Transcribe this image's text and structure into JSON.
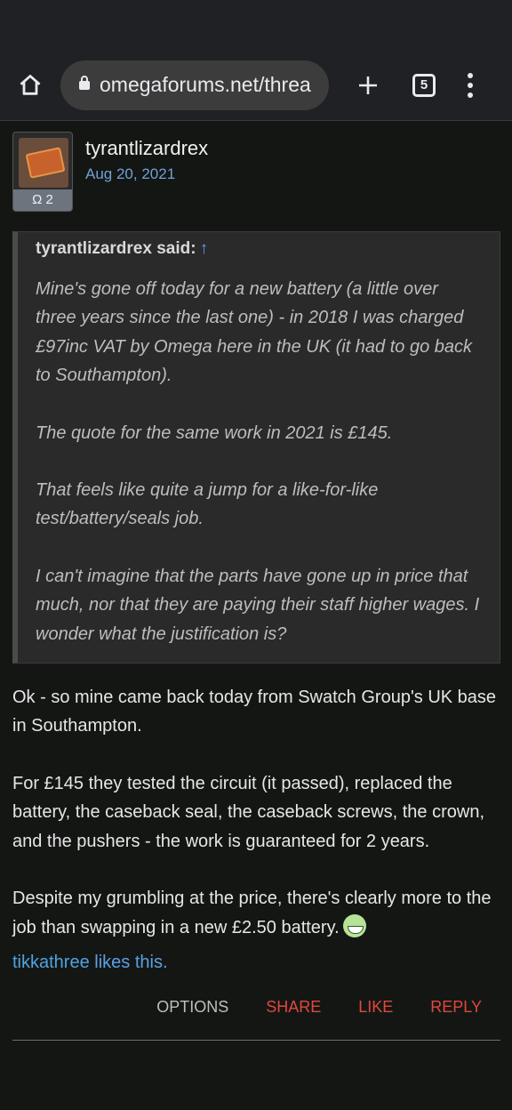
{
  "browser": {
    "url": "omegaforums.net/threa",
    "tab_count": "5"
  },
  "post": {
    "avatar_badge": "Ω 2",
    "username": "tyrantlizardrex",
    "date": "Aug 20, 2021",
    "quote": {
      "author": "tyrantlizardrex said:",
      "arrow": "↑",
      "paragraphs": [
        "Mine's gone off today for a new battery (a little over three years since the last one) - in 2018 I was charged £97inc VAT by Omega here in the UK (it had to go back to Southampton).",
        "The quote for the same work in 2021 is £145.",
        "That feels like quite a jump for a like-for-like test/battery/seals job.",
        "I can't imagine that the parts have gone up in price that much, nor that they are paying their staff higher wages. I wonder what the justification is?"
      ]
    },
    "message": {
      "paragraphs": [
        "Ok - so mine came back today from Swatch Group's UK base in Southampton.",
        "For £145 they tested the circuit (it passed), replaced the battery, the caseback seal, the caseback screws, the crown, and the pushers - the work is guaranteed for 2 years.",
        "Despite my grumbling at the price, there's clearly more to the job than swapping in a new £2.50 battery."
      ],
      "emoji": "grin-emoji"
    },
    "likes": {
      "user": "tikkathree",
      "text": " likes this."
    },
    "actions": {
      "options": "OPTIONS",
      "share": "SHARE",
      "like": "LIKE",
      "reply": "REPLY"
    }
  },
  "colors": {
    "link": "#5aa0e6",
    "action_red": "#e0483b",
    "background": "#141614"
  }
}
